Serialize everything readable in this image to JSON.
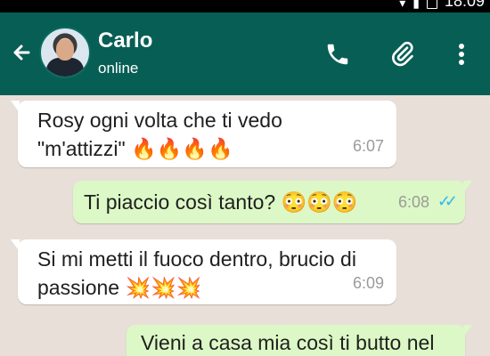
{
  "status_bar": {
    "time": "18:09"
  },
  "header": {
    "contact_name": "Carlo",
    "status": "online"
  },
  "messages": [
    {
      "direction": "in",
      "text": "Rosy ogni volta che ti vedo\n\"m'attizzi\" 🔥🔥🔥🔥",
      "time": "6:07"
    },
    {
      "direction": "out",
      "text": "Ti piaccio così tanto? 😳😳😳",
      "time": "6:08",
      "status": "read"
    },
    {
      "direction": "in",
      "text": "Si mi metti il fuoco dentro, brucio di\npassione 💥💥💥",
      "time": "6:09"
    },
    {
      "direction": "out",
      "text": "Vieni a casa mia così ti butto nel",
      "time": ""
    }
  ],
  "colors": {
    "header": "#075e54",
    "incoming": "#ffffff",
    "outgoing": "#dcf8c6",
    "read_ticks": "#34b7f1"
  },
  "icons": [
    "back-arrow-icon",
    "phone-icon",
    "paperclip-icon",
    "more-vert-icon"
  ]
}
